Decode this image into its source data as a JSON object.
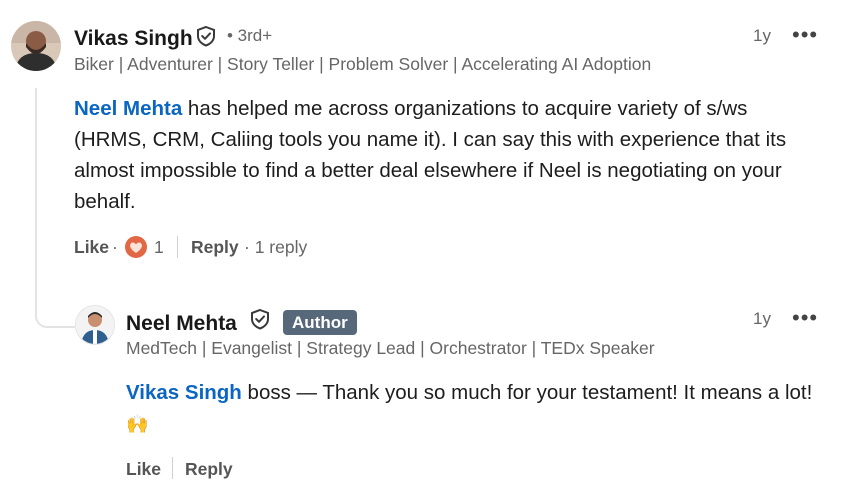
{
  "comment": {
    "author": "Vikas Singh",
    "degree": "• 3rd+",
    "headline": "Biker | Adventurer | Story Teller | Problem Solver | Accelerating AI Adoption",
    "time": "1y",
    "mention": "Neel Mehta",
    "text": " has helped me across organizations to acquire variety of s/ws (HRMS, CRM, Caliing tools you name it). I can say this with experience that its almost impossible to find a better deal elsewhere if Neel is negotiating on your behalf.",
    "like_label": "Like",
    "dot": "·",
    "reaction_count": "1",
    "reply_label": "Reply",
    "reply_count": "· 1 reply"
  },
  "reply": {
    "author": "Neel Mehta",
    "badge": "Author",
    "headline": "MedTech | Evangelist | Strategy Lead | Orchestrator | TEDx Speaker",
    "time": "1y",
    "mention": "Vikas Singh",
    "text": " boss — Thank you so much for your testament! It means a lot!",
    "emoji": "🙌",
    "like_label": "Like",
    "reply_label": "Reply"
  },
  "menu_icon": "•••",
  "colors": {
    "link": "#0a66c2",
    "badge_bg": "#56687a",
    "love_reaction": "#e16745"
  },
  "icons": [
    "verified-shield-icon",
    "love-reaction-icon",
    "more-options-icon",
    "raising-hands-emoji"
  ]
}
